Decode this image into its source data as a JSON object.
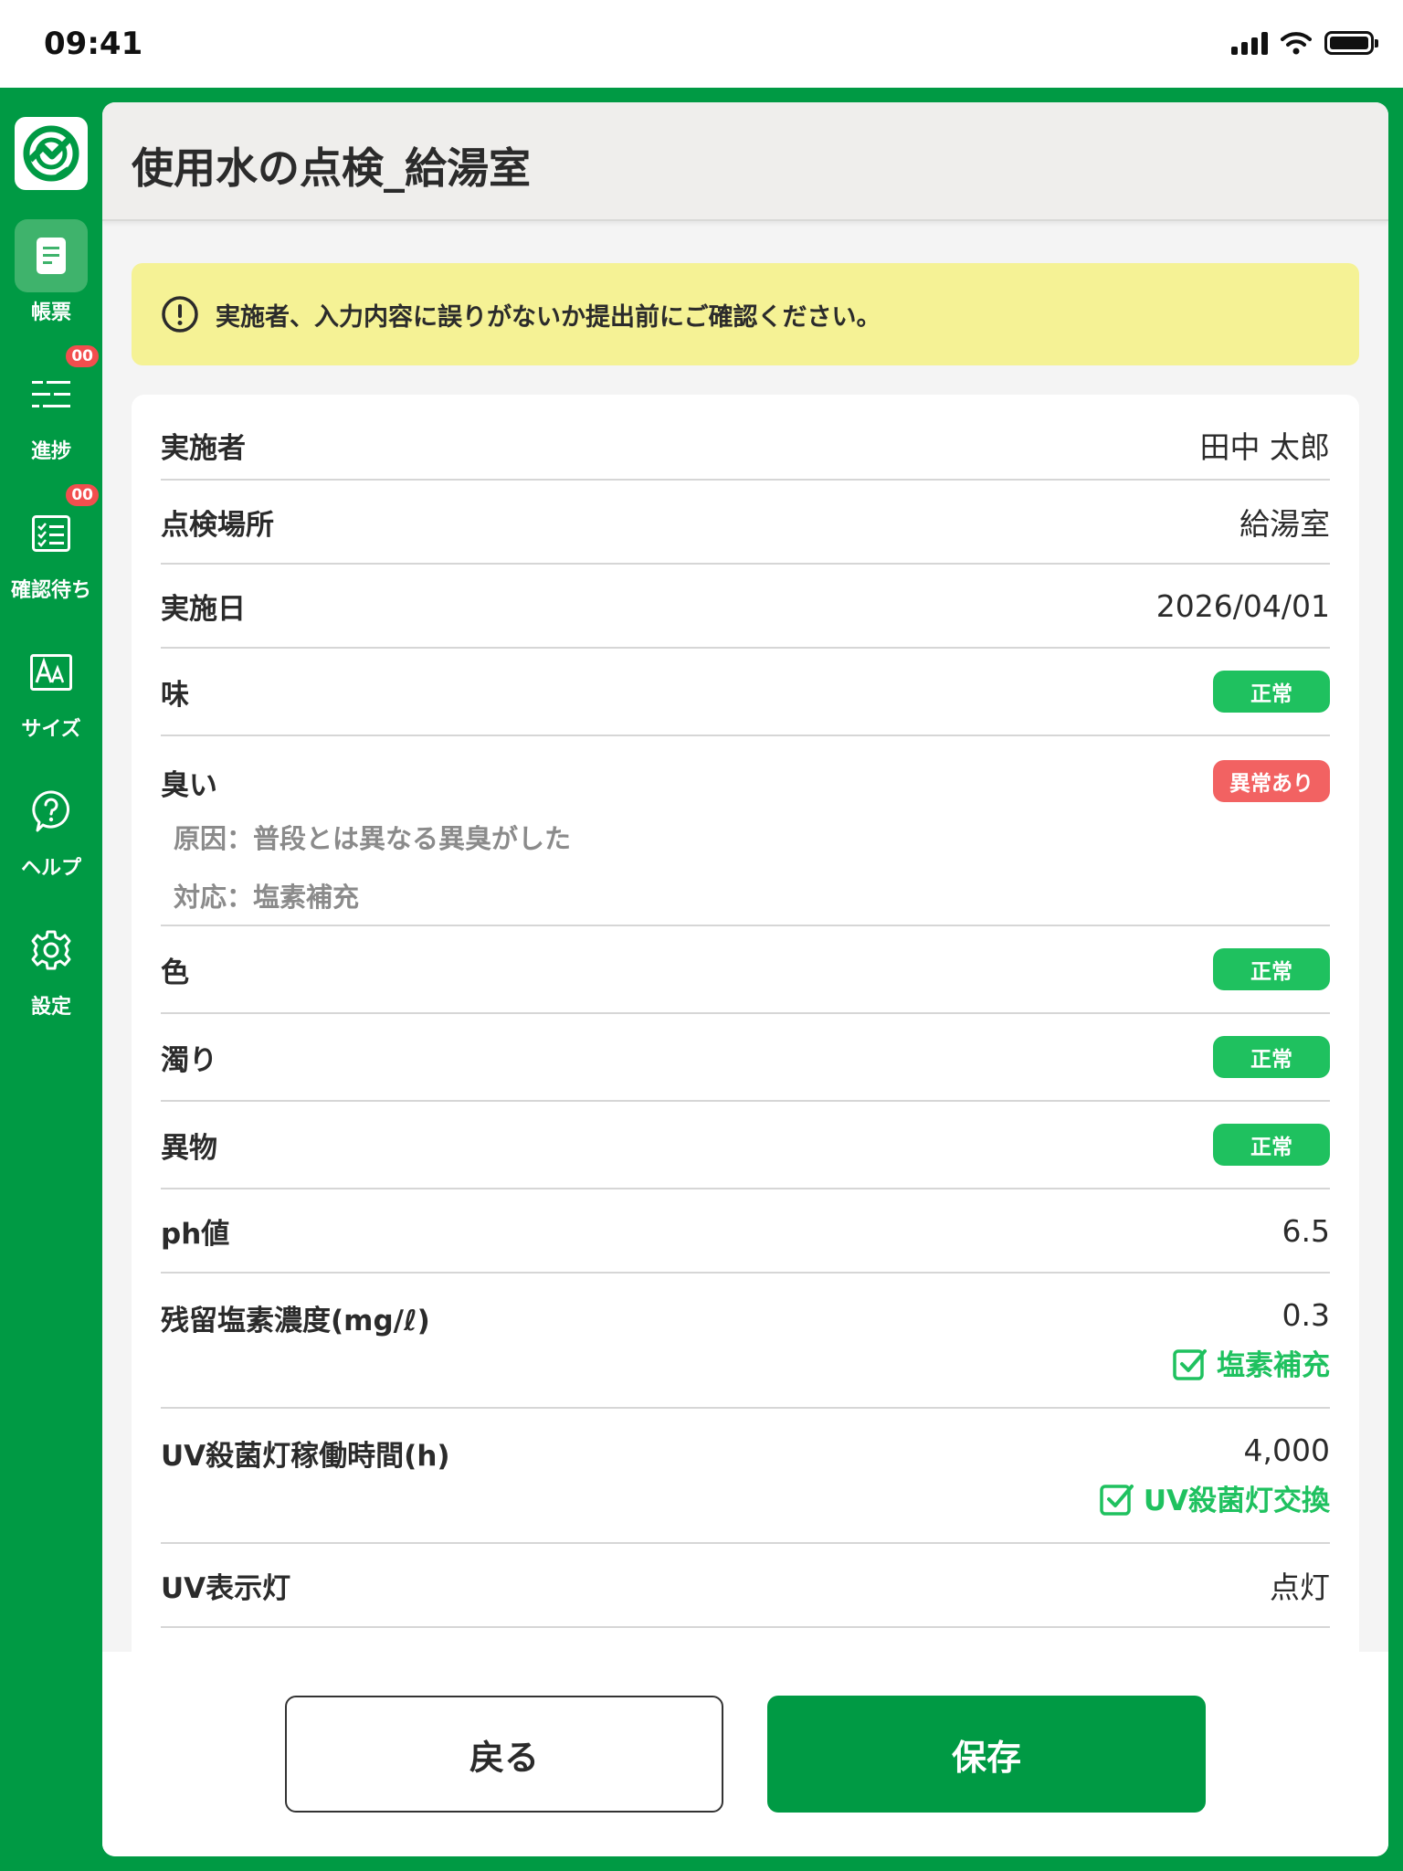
{
  "status_bar": {
    "time": "09:41"
  },
  "sidebar": {
    "items": [
      {
        "label": "帳票",
        "icon": "document-icon",
        "active": true
      },
      {
        "label": "進捗",
        "icon": "progress-list-icon",
        "badge": "00"
      },
      {
        "label": "確認待ち",
        "icon": "checklist-icon",
        "badge": "00"
      },
      {
        "label": "サイズ",
        "icon": "font-size-icon"
      },
      {
        "label": "ヘルプ",
        "icon": "help-icon"
      },
      {
        "label": "設定",
        "icon": "gear-icon"
      }
    ]
  },
  "header": {
    "title": "使用水の点検_給湯室"
  },
  "notice": {
    "icon": "alert-circle-icon",
    "text": "実施者、入力内容に誤りがないか提出前にご確認ください。"
  },
  "rows": {
    "performer": {
      "label": "実施者",
      "value": "田中 太郎"
    },
    "location": {
      "label": "点検場所",
      "value": "給湯室"
    },
    "date": {
      "label": "実施日",
      "value": "2026/04/01"
    },
    "taste": {
      "label": "味",
      "status": "正常"
    },
    "smell": {
      "label": "臭い",
      "status": "異常あり",
      "cause": "原因：普段とは異なる異臭がした",
      "action": "対応：塩素補充"
    },
    "color": {
      "label": "色",
      "status": "正常"
    },
    "turbidity": {
      "label": "濁り",
      "status": "正常"
    },
    "foreign": {
      "label": "異物",
      "status": "正常"
    },
    "ph": {
      "label": "ph値",
      "value": "6.5"
    },
    "chlorine": {
      "label": "残留塩素濃度(mg/ℓ)",
      "value": "0.3",
      "check_label": "塩素補充"
    },
    "uv_hours": {
      "label": "UV殺菌灯稼働時間(h)",
      "value": "4,000",
      "check_label": "UV殺菌灯交換"
    },
    "uv_light": {
      "label": "UV表示灯",
      "value": "点灯"
    }
  },
  "footer": {
    "back_label": "戻る",
    "save_label": "保存"
  },
  "colors": {
    "brand": "#009a44",
    "ok": "#1fc15f",
    "ng": "#f26262",
    "notice_bg": "#f5f295"
  }
}
